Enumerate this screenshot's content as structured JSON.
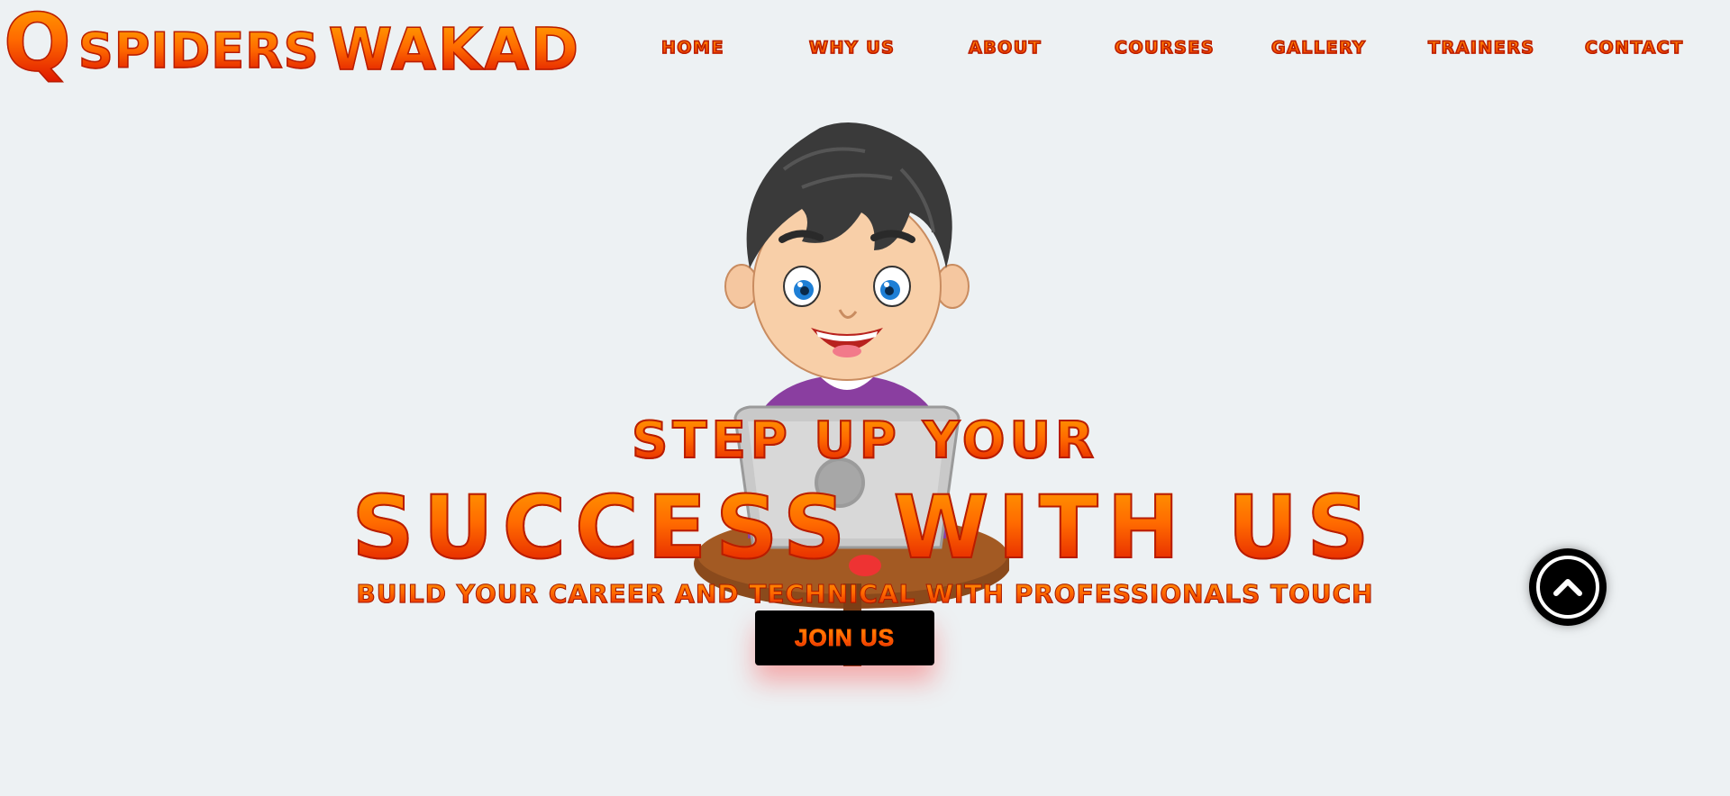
{
  "logo": {
    "q": "Q",
    "spiders": "SPIDERS",
    "wakad": "WAKAD"
  },
  "nav": [
    "HOME",
    "WHY US",
    "ABOUT",
    "COURSES",
    "GALLERY",
    "TRAINERS",
    "CONTACT"
  ],
  "hero": {
    "line1": "STEP UP YOUR",
    "line2": "SUCCESS WITH US",
    "line3": "BUILD YOUR CAREER AND TECHNICAL WITH PROFESSIONALS TOUCH",
    "button": "JOIN US"
  },
  "icons": {
    "illustration": "boy-with-laptop-illustration",
    "scroll_top": "chevron-up-icon"
  },
  "colors": {
    "gradient_top": "#ff9a00",
    "gradient_bottom": "#e01a00",
    "background": "#edf1f3",
    "button_bg": "#000000"
  }
}
